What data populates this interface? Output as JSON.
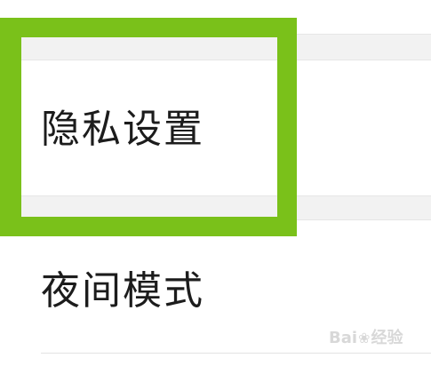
{
  "top_fragment": {
    "text": "."
  },
  "settings": {
    "items": [
      {
        "label": "隐私设置"
      },
      {
        "label": "夜间模式"
      }
    ]
  },
  "highlight": {
    "color": "#7ac11a"
  },
  "watermark": {
    "text_left": "Bai",
    "paw_icon": "paw-icon",
    "text_right": "经验"
  }
}
